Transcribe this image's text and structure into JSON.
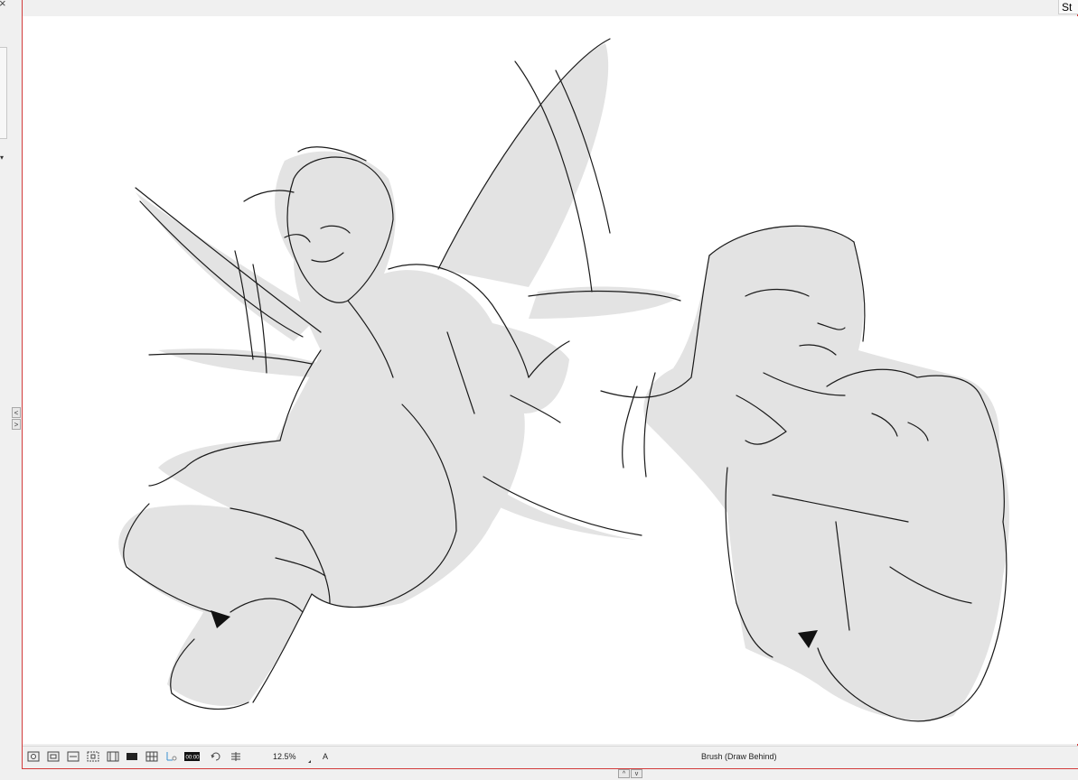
{
  "window": {
    "close_glyph": "×",
    "top_right_tab_label": "St"
  },
  "left_panel": {
    "collapse_left_glyph": "<",
    "collapse_right_glyph": ">"
  },
  "canvas": {
    "content": "sketch-artwork",
    "background": "#ffffff"
  },
  "statusbar": {
    "icons": [
      "camera-view-icon",
      "safe-area-icon",
      "field-guide-icon",
      "frame-fit-icon",
      "film-strip-icon",
      "background-toggle-icon",
      "grid-icon",
      "onion-skin-icon",
      "timecode-icon",
      "reset-rotation-icon",
      "pan-reset-icon"
    ],
    "timecode_text": "00:00",
    "zoom_level": "12.5%",
    "a_label": "A",
    "current_tool": "Brush (Draw Behind)"
  },
  "bottom_arrows": {
    "up_glyph": "^",
    "down_glyph": "v"
  },
  "colors": {
    "frame_red": "#d23c3c",
    "canvas_white": "#ffffff",
    "ui_gray": "#f0f0f0",
    "sketch_fill": "#e3e3e3",
    "sketch_line": "#1a1a1a"
  }
}
